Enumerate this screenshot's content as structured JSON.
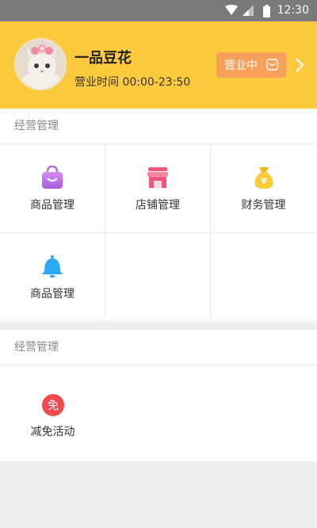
{
  "status_bar": {
    "time": "12:30"
  },
  "header": {
    "shop_name": "一品豆花",
    "hours": "营业时间 00:00-23:50",
    "status_label": "营业中"
  },
  "sections": [
    {
      "title": "经营管理",
      "items": [
        {
          "label": "商品管理",
          "icon": "shopping-bag-icon"
        },
        {
          "label": "店铺管理",
          "icon": "storefront-icon"
        },
        {
          "label": "财务管理",
          "icon": "money-bag-icon"
        },
        {
          "label": "商品管理",
          "icon": "bell-icon"
        }
      ]
    },
    {
      "title": "经营管理",
      "items": [
        {
          "label": "减免活动",
          "icon": "free-badge-icon",
          "badge_text": "免"
        }
      ]
    }
  ],
  "colors": {
    "header_bg": "#fcc93f",
    "status_button_bg": "#f6a05a",
    "status_bar_bg": "#7a7a7a",
    "page_bg": "#efefef"
  }
}
